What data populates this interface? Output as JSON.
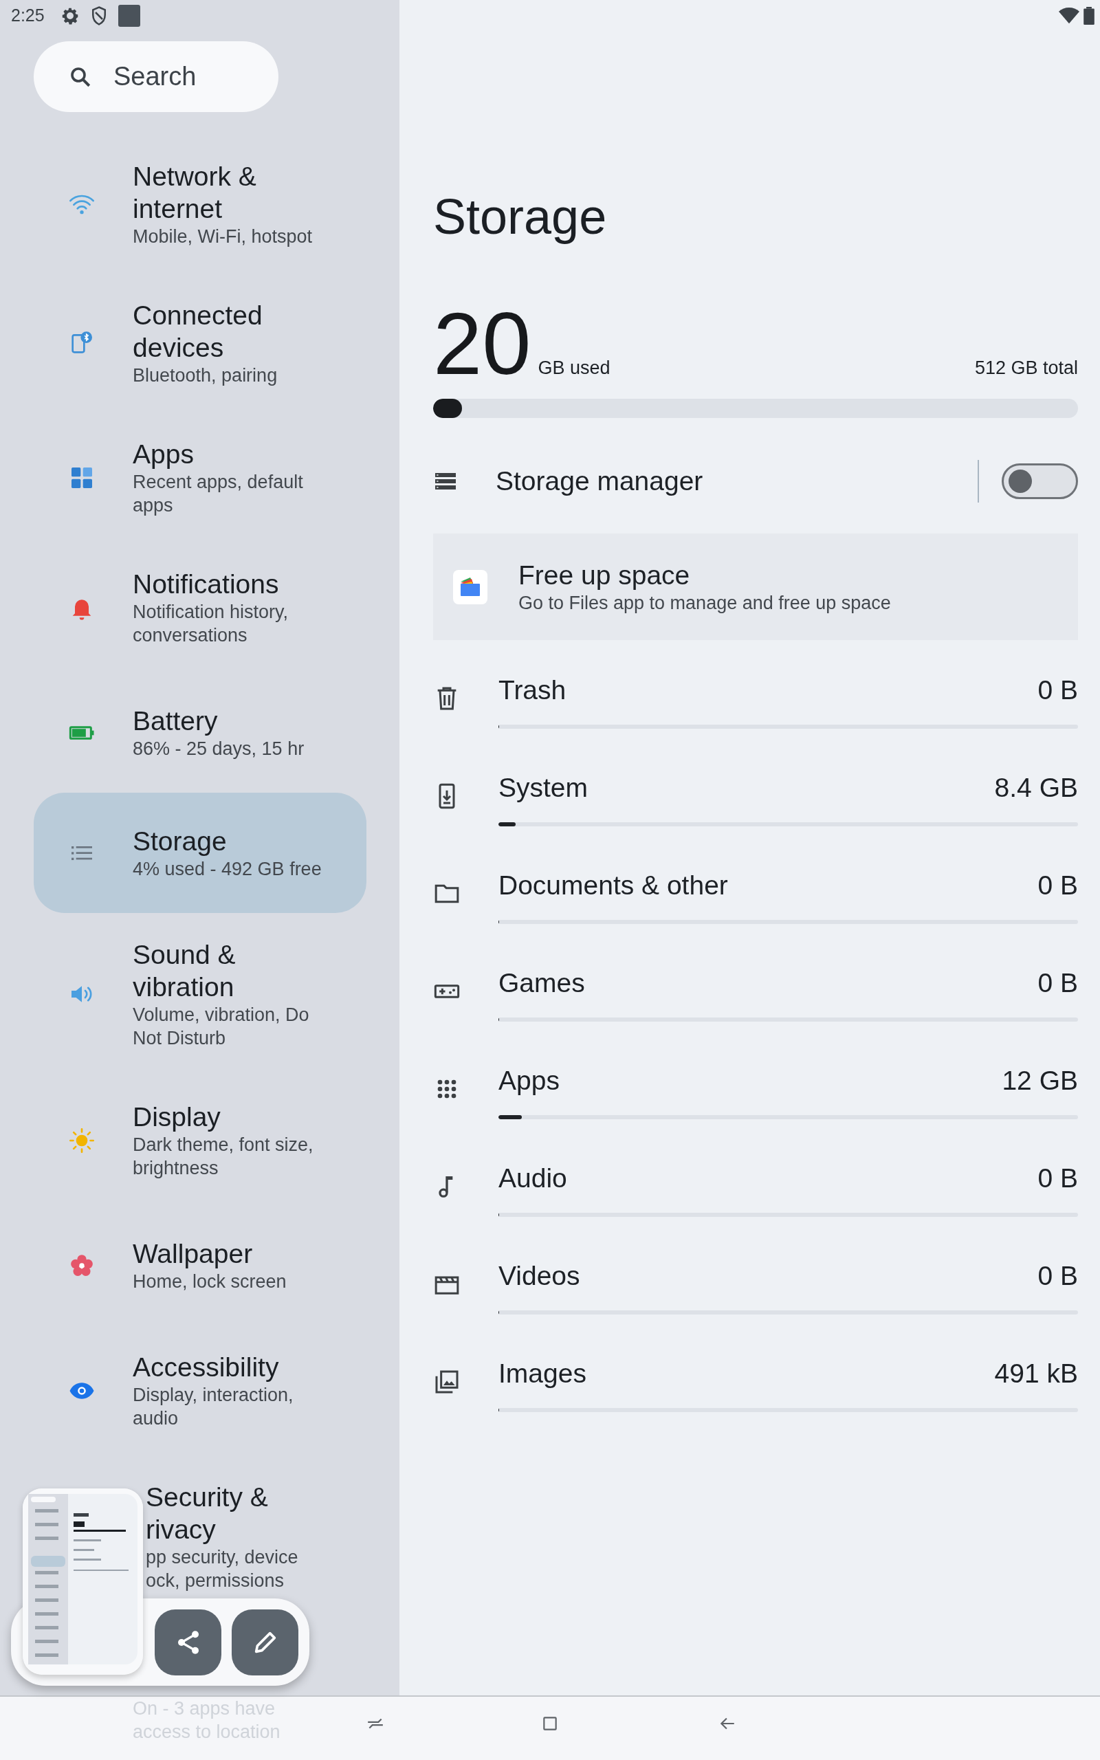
{
  "status_bar": {
    "time": "2:25"
  },
  "search": {
    "placeholder": "Search"
  },
  "sidebar": {
    "items": [
      {
        "kind": "full",
        "title": "Network &\ninternet",
        "subtitle": "Mobile, Wi-Fi, hotspot",
        "selected": false
      },
      {
        "kind": "full",
        "title": "Connected\ndevices",
        "subtitle": "Bluetooth, pairing",
        "selected": false
      },
      {
        "kind": "full",
        "title": "Apps",
        "subtitle": "Recent apps, default\napps",
        "selected": false
      },
      {
        "kind": "full",
        "title": "Notifications",
        "subtitle": "Notification history,\nconversations",
        "selected": false
      },
      {
        "kind": "full",
        "title": "Battery",
        "subtitle": "86% - 25 days, 15 hr",
        "selected": false
      },
      {
        "kind": "full",
        "title": "Storage",
        "subtitle": "4% used - 492 GB free",
        "selected": true
      },
      {
        "kind": "full",
        "title": "Sound &\nvibration",
        "subtitle": "Volume, vibration, Do\nNot Disturb",
        "selected": false
      },
      {
        "kind": "full",
        "title": "Display",
        "subtitle": "Dark theme, font size,\nbrightness",
        "selected": false
      },
      {
        "kind": "full",
        "title": "Wallpaper",
        "subtitle": "Home, lock screen",
        "selected": false
      },
      {
        "kind": "full",
        "title": "Accessibility",
        "subtitle": "Display, interaction,\naudio",
        "selected": false
      },
      {
        "kind": "partial",
        "title": "Security &\nrivacy",
        "subtitle": "pp security, device\nock, permissions",
        "selected": false
      },
      {
        "kind": "covered",
        "subtitle": "On - 3 apps have\naccess to location"
      }
    ]
  },
  "page": {
    "title": "Storage",
    "used_value": "20",
    "used_unit": "GB used",
    "total": "512 GB total",
    "level": 0.045
  },
  "storage_manager": {
    "label": "Storage manager",
    "on": false
  },
  "free_up": {
    "title": "Free up space",
    "subtitle": "Go to Files app to manage and free up space"
  },
  "categories": [
    {
      "label": "Trash",
      "value": "0 B",
      "level": 0
    },
    {
      "label": "System",
      "value": "8.4 GB",
      "level": 0.03
    },
    {
      "label": "Documents & other",
      "value": "0 B",
      "level": 0
    },
    {
      "label": "Games",
      "value": "0 B",
      "level": 0
    },
    {
      "label": "Apps",
      "value": "12 GB",
      "level": 0.04
    },
    {
      "label": "Audio",
      "value": "0 B",
      "level": 0
    },
    {
      "label": "Videos",
      "value": "0 B",
      "level": 0
    },
    {
      "label": "Images",
      "value": "491 kB",
      "level": 0
    }
  ]
}
